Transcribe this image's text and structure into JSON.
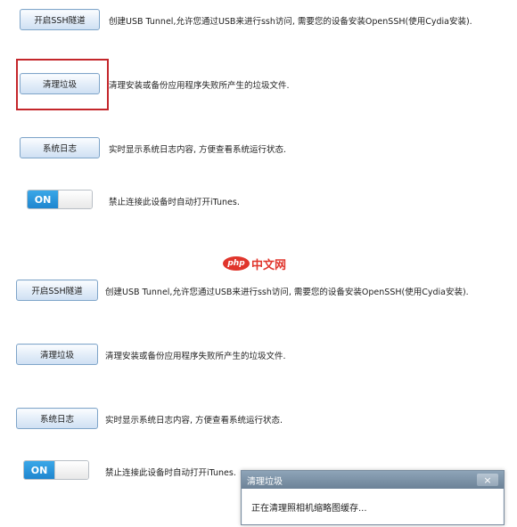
{
  "top": {
    "ssh_button": "开启SSH隧道",
    "ssh_desc": "创建USB Tunnel,允许您通过USB来进行ssh访问, 需要您的设备安装OpenSSH(使用Cydia安装).",
    "clean_button": "清理垃圾",
    "clean_desc": "清理安装或备份应用程序失败所产生的垃圾文件.",
    "log_button": "系统日志",
    "log_desc": "实时显示系统日志内容, 方便查看系统运行状态.",
    "toggle_label": "ON",
    "toggle_desc": "禁止连接此设备时自动打开iTunes."
  },
  "bottom": {
    "ssh_button": "开启SSH隧道",
    "ssh_desc": "创建USB Tunnel,允许您通过USB来进行ssh访问, 需要您的设备安装OpenSSH(使用Cydia安装).",
    "clean_button": "清理垃圾",
    "clean_desc": "清理安装或备份应用程序失败所产生的垃圾文件.",
    "log_button": "系统日志",
    "log_desc": "实时显示系统日志内容, 方便查看系统运行状态.",
    "toggle_label": "ON",
    "toggle_desc": "禁止连接此设备时自动打开iTunes."
  },
  "watermark": {
    "logo": "php",
    "text": "中文网"
  },
  "dialog": {
    "title": "清理垃圾",
    "close": "×",
    "message": "正在清理照相机缩略图缓存..."
  },
  "colors": {
    "highlight": "#c4262b",
    "toggle_on": "#1f86cf",
    "watermark": "#e0352c"
  }
}
